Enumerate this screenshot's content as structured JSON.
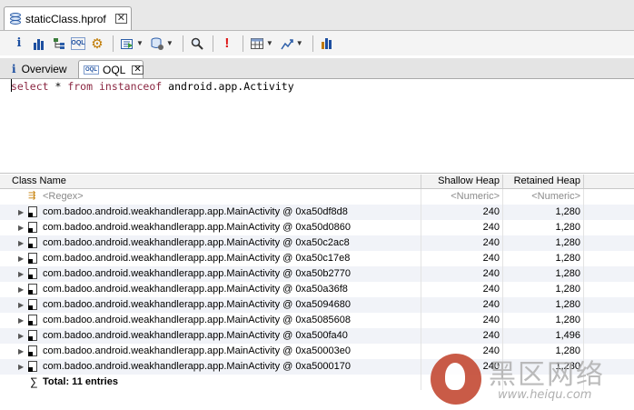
{
  "editor": {
    "file_tab": "staticClass.hprof"
  },
  "toolbar": {
    "icons": [
      "info-icon",
      "histogram-icon",
      "dominator-tree-icon",
      "oql-icon",
      "gear-icon",
      "run-report-icon",
      "query-browser-icon",
      "search-icon",
      "alert-icon",
      "grid-icon",
      "export-icon",
      "compare-icon"
    ]
  },
  "view_tabs": {
    "overview": "Overview",
    "oql": "OQL"
  },
  "query": {
    "select_kw": "select",
    "star": " * ",
    "from_kw": "from",
    "instanceof_kw": "instanceof",
    "class_name": " android.app.Activity"
  },
  "table": {
    "headers": {
      "class_name": "Class Name",
      "shallow_heap": "Shallow Heap",
      "retained_heap": "Retained Heap"
    },
    "filter_row": {
      "name": "<Regex>",
      "shallow": "<Numeric>",
      "retained": "<Numeric>"
    },
    "rows": [
      {
        "name": "com.badoo.android.weakhandlerapp.app.MainActivity @ 0xa50df8d8",
        "shallow": "240",
        "retained": "1,280"
      },
      {
        "name": "com.badoo.android.weakhandlerapp.app.MainActivity @ 0xa50d0860",
        "shallow": "240",
        "retained": "1,280"
      },
      {
        "name": "com.badoo.android.weakhandlerapp.app.MainActivity @ 0xa50c2ac8",
        "shallow": "240",
        "retained": "1,280"
      },
      {
        "name": "com.badoo.android.weakhandlerapp.app.MainActivity @ 0xa50c17e8",
        "shallow": "240",
        "retained": "1,280"
      },
      {
        "name": "com.badoo.android.weakhandlerapp.app.MainActivity @ 0xa50b2770",
        "shallow": "240",
        "retained": "1,280"
      },
      {
        "name": "com.badoo.android.weakhandlerapp.app.MainActivity @ 0xa50a36f8",
        "shallow": "240",
        "retained": "1,280"
      },
      {
        "name": "com.badoo.android.weakhandlerapp.app.MainActivity @ 0xa5094680",
        "shallow": "240",
        "retained": "1,280"
      },
      {
        "name": "com.badoo.android.weakhandlerapp.app.MainActivity @ 0xa5085608",
        "shallow": "240",
        "retained": "1,280"
      },
      {
        "name": "com.badoo.android.weakhandlerapp.app.MainActivity @ 0xa500fa40",
        "shallow": "240",
        "retained": "1,496"
      },
      {
        "name": "com.badoo.android.weakhandlerapp.app.MainActivity @ 0xa50003e0",
        "shallow": "240",
        "retained": "1,280"
      },
      {
        "name": "com.badoo.android.weakhandlerapp.app.MainActivity @ 0xa5000170",
        "shallow": "240",
        "retained": "1,280"
      }
    ],
    "total": "Total: 11 entries"
  },
  "watermark": {
    "text": "黑区网络",
    "url": "www.heiqu.com"
  }
}
